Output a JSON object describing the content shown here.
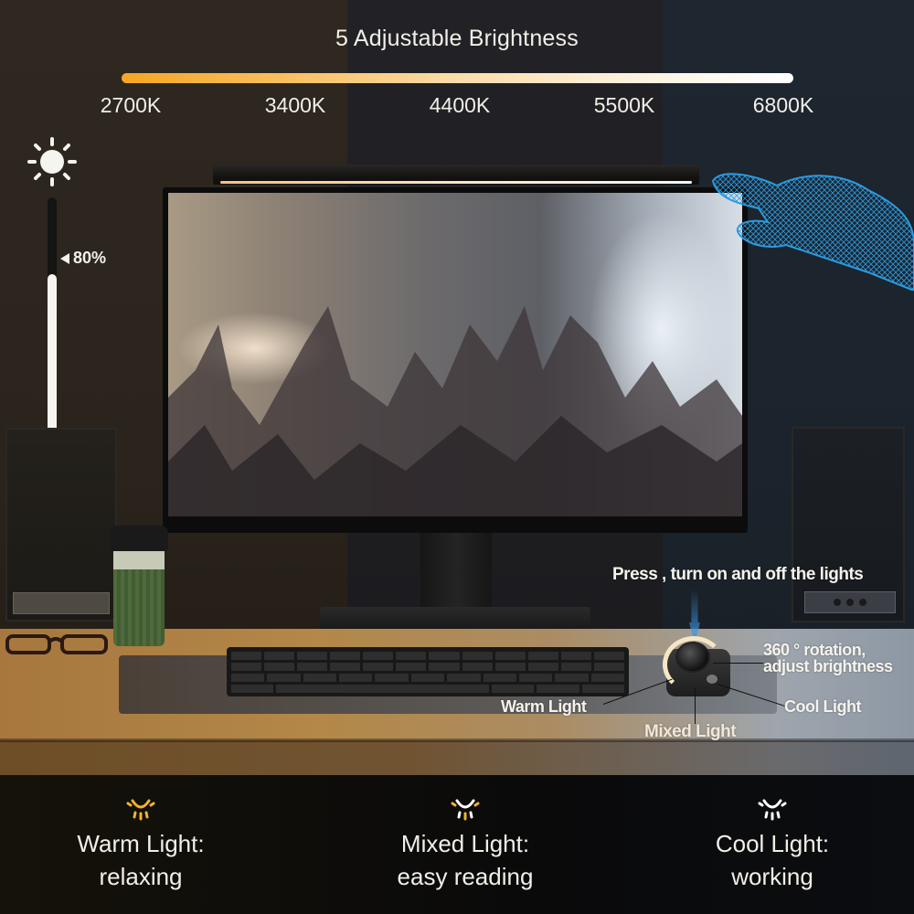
{
  "header": {
    "title": "5 Adjustable Brightness",
    "color_temperature_scale": {
      "labels": [
        "2700K",
        "3400K",
        "4400K",
        "5500K",
        "6800K"
      ],
      "gradient_colors": [
        "#f5a623",
        "#ffffff"
      ]
    }
  },
  "brightness": {
    "icon": "sun-icon",
    "level_percent": 80,
    "label": "80%"
  },
  "controller": {
    "press_label": "Press , turn on and off the lights",
    "rotate_label_line1": "360 ° rotation,",
    "rotate_label_line2": "adjust brightness",
    "warm_label": "Warm Light",
    "mixed_label": "Mixed Light",
    "cool_label": "Cool Light"
  },
  "modes": [
    {
      "icon": "warm-light-icon",
      "icon_color": "#f0b232",
      "title": "Warm Light:",
      "desc": "relaxing"
    },
    {
      "icon": "mixed-light-icon",
      "icon_color": "#f3dca0",
      "title": "Mixed Light:",
      "desc": "easy reading"
    },
    {
      "icon": "cool-light-icon",
      "icon_color": "#ffffff",
      "title": "Cool Light:",
      "desc": "working"
    }
  ],
  "colors": {
    "warm": "#f0b232",
    "cool": "#ffffff",
    "hand_wireframe": "#2a9be0",
    "press_arrow": "#3c96e6"
  }
}
